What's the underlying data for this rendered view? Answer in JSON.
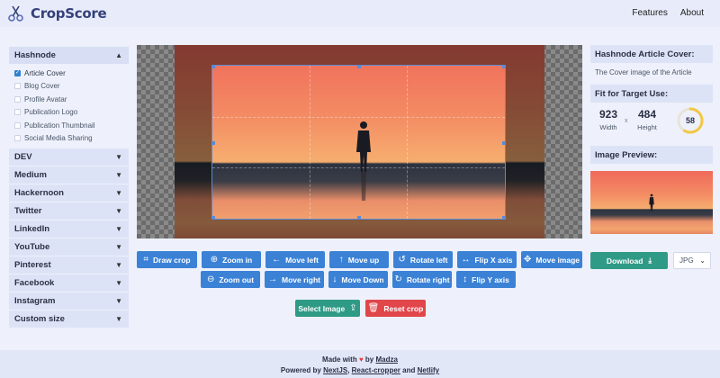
{
  "app": {
    "name": "CropScore"
  },
  "nav": {
    "features": "Features",
    "about": "About"
  },
  "sidebar": {
    "open_section": {
      "label": "Hashnode",
      "items": [
        {
          "label": "Article Cover",
          "checked": true
        },
        {
          "label": "Blog Cover",
          "checked": false
        },
        {
          "label": "Profile Avatar",
          "checked": false
        },
        {
          "label": "Publication Logo",
          "checked": false
        },
        {
          "label": "Publication Thumbnail",
          "checked": false
        },
        {
          "label": "Social Media Sharing",
          "checked": false
        }
      ]
    },
    "sections": [
      "DEV",
      "Medium",
      "Hackernoon",
      "Twitter",
      "LinkedIn",
      "YouTube",
      "Pinterest",
      "Facebook",
      "Instagram",
      "Custom size"
    ]
  },
  "toolbar": {
    "row1": [
      "Draw crop",
      "Zoom in",
      "Move left",
      "Move up",
      "Rotate left",
      "Flip X axis",
      "Move image"
    ],
    "row2": [
      "Zoom out",
      "Move right",
      "Move Down",
      "Rotate right",
      "Flip Y axis"
    ],
    "select_image": "Select Image",
    "reset_crop": "Reset crop"
  },
  "info": {
    "target_title": "Hashnode Article Cover:",
    "target_desc": "The Cover image of the Article",
    "fit_title": "Fit for Target Use:",
    "width": 923,
    "width_label": "Width",
    "times": "x",
    "height": 484,
    "height_label": "Height",
    "score": 58,
    "score_max": 100,
    "preview_title": "Image Preview:",
    "download": "Download",
    "format": "JPG"
  },
  "footer": {
    "made_with": "Made with",
    "by": "by",
    "author": "Madza",
    "powered_by": "Powered by",
    "tech1": "NextJS",
    "tech2": "React-cropper",
    "and": "and",
    "tech3": "Netlify"
  },
  "colors": {
    "primary": "#3b82d6",
    "success": "#2f9a86",
    "danger": "#e0464a",
    "gauge": "#f2c744"
  }
}
